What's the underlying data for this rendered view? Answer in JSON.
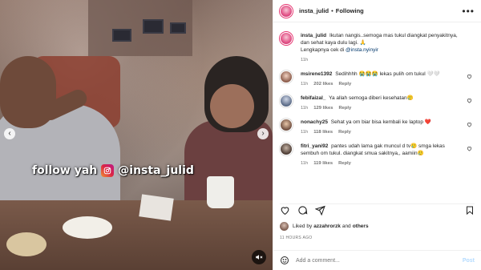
{
  "post": {
    "username": "insta_julid",
    "separator": "•",
    "follow_status": "Following",
    "more_label": "•••"
  },
  "media": {
    "watermark_text": "follow yah",
    "watermark_handle": "@insta_julid",
    "prev_label": "‹",
    "next_label": "›"
  },
  "caption": {
    "username": "insta_julid",
    "text": "Ikutan nangis..semoga mas tukul diangkat penyakitnya, dan sehat kaya dulu lagi. 🙏",
    "text2": "Lengkapnya cek di",
    "link": "@insta.nyinyir",
    "time": "11h"
  },
  "comments": [
    {
      "username": "msirene1392",
      "text": "Sedihhhh 😭😭😭 lekas pulih om tukul 🤍🤍",
      "time": "11h",
      "likes": "202 likes",
      "reply": "Reply"
    },
    {
      "username": "febifaizal_",
      "text": "Ya allah semoga diberi kesehatan🥲",
      "time": "11h",
      "likes": "129 likes",
      "reply": "Reply"
    },
    {
      "username": "nonachy25",
      "text": "Sehat ya om biar bisa kembali ke laptop ❤️",
      "time": "11h",
      "likes": "118 likes",
      "reply": "Reply"
    },
    {
      "username": "fitri_yani92",
      "text": "pantes udah lama gak muncul d tv🥲 smga lekas sembuh om tukul. diangkat smua sakitnya,, aamiin🥲",
      "time": "11h",
      "likes": "119 likes",
      "reply": "Reply"
    }
  ],
  "likes": {
    "prefix": "Liked by",
    "user": "azzahrorzk",
    "and": "and",
    "others": "others"
  },
  "timestamp": "11 HOURS AGO",
  "composer": {
    "placeholder": "Add a comment...",
    "post_label": "Post"
  },
  "icons": [
    "heart-icon",
    "comment-icon",
    "share-icon",
    "bookmark-icon",
    "emoji-icon",
    "instagram-icon",
    "mute-icon",
    "chevron-left-icon",
    "chevron-right-icon",
    "more-icon"
  ]
}
